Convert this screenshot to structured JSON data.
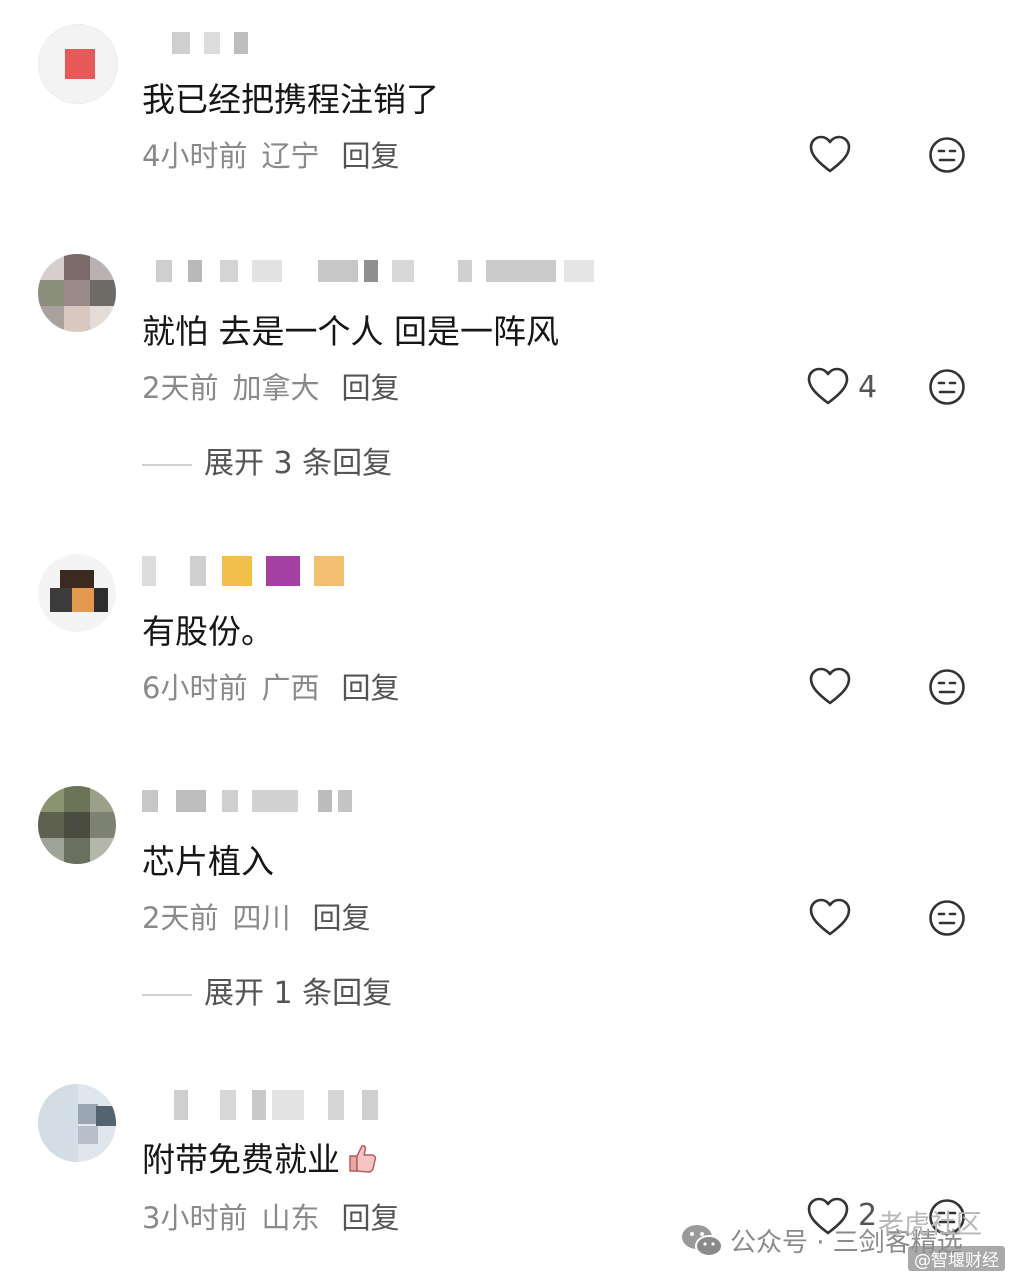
{
  "comments": [
    {
      "text": "我已经把携程注销了",
      "time": "4小时前",
      "location": "辽宁",
      "reply": "回复",
      "likes": ""
    },
    {
      "text": "就怕 去是一个人 回是一阵风",
      "time": "2天前",
      "location": "加拿大",
      "reply": "回复",
      "likes": "4",
      "expand": "展开 3 条回复"
    },
    {
      "text": "有股份。",
      "time": "6小时前",
      "location": "广西",
      "reply": "回复",
      "likes": ""
    },
    {
      "text": "芯片植入",
      "time": "2天前",
      "location": "四川",
      "reply": "回复",
      "likes": "",
      "expand": "展开 1 条回复"
    },
    {
      "text": "附带免费就业",
      "time": "3小时前",
      "location": "山东",
      "reply": "回复",
      "likes": "2"
    }
  ],
  "icons": {
    "like": "heart-outline-icon",
    "dislike": "neutral-face-icon",
    "emoji": "thumbs-up-emoji-icon",
    "watermark": "wechat-logo-icon"
  },
  "watermark": {
    "account": "公众号 · 三剑客精选",
    "community": "老虎社区",
    "handle": "@智堰财经"
  },
  "colors": {
    "text": "#161616",
    "meta": "#8a8a8a",
    "reply": "#555555",
    "icon": "#333333"
  }
}
